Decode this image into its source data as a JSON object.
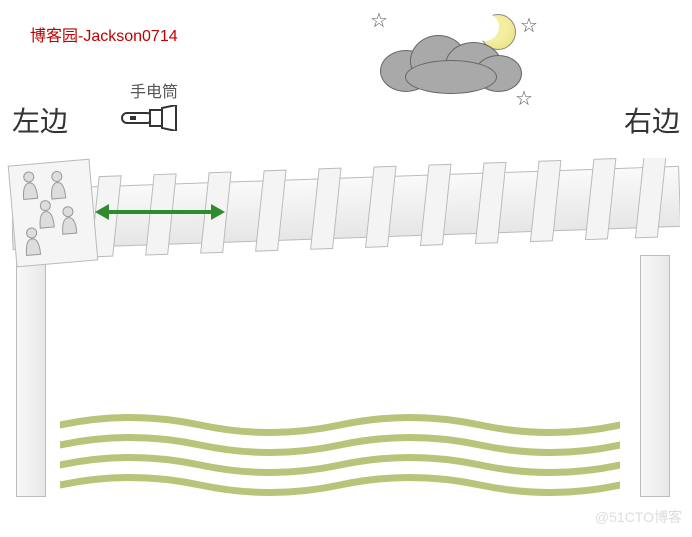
{
  "attribution": "博客园-Jackson0714",
  "labels": {
    "flashlight": "手电筒",
    "left": "左边",
    "right": "右边"
  },
  "watermark": "@51CTO博客",
  "icons": {
    "flashlight": "flashlight-icon",
    "moon": "moon-icon",
    "cloud": "cloud-icon",
    "star": "star-icon",
    "person": "person-icon",
    "arrow": "double-arrow-icon"
  },
  "scene": {
    "people_count": 5,
    "bridge_planks": 12,
    "stars": 3,
    "water_waves": 4
  },
  "colors": {
    "attribution": "#c00000",
    "arrow": "#2e8b2e",
    "water": "#b8c47a",
    "cloud": "#a9a9a9",
    "moon": "#f2e98c"
  }
}
